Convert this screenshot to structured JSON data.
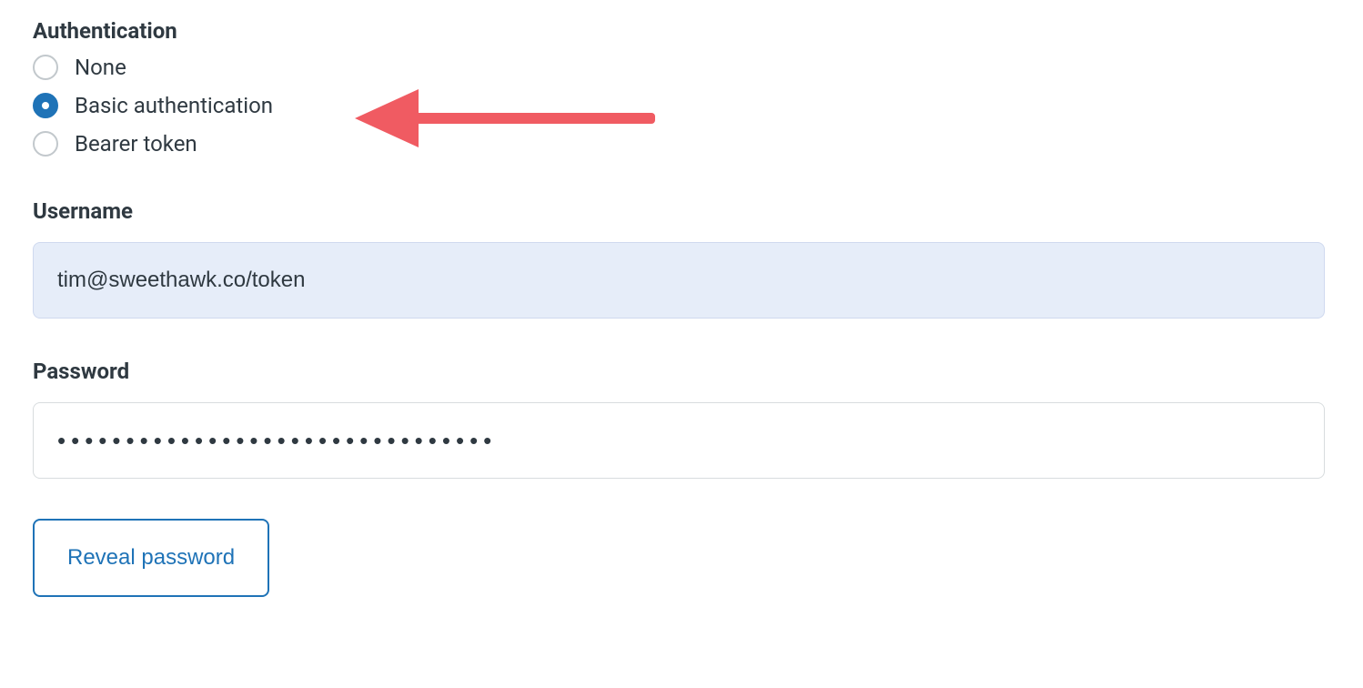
{
  "auth": {
    "title": "Authentication",
    "options": {
      "none": {
        "label": "None",
        "selected": false
      },
      "basic": {
        "label": "Basic authentication",
        "selected": true
      },
      "bearer": {
        "label": "Bearer token",
        "selected": false
      }
    }
  },
  "username": {
    "label": "Username",
    "value": "tim@sweethawk.co/token"
  },
  "password": {
    "label": "Password",
    "value": "••••••••••••••••••••••••••••••••"
  },
  "reveal": {
    "label": "Reveal password"
  },
  "annotation": {
    "color": "#f05b62",
    "target": "auth-option-basic"
  }
}
